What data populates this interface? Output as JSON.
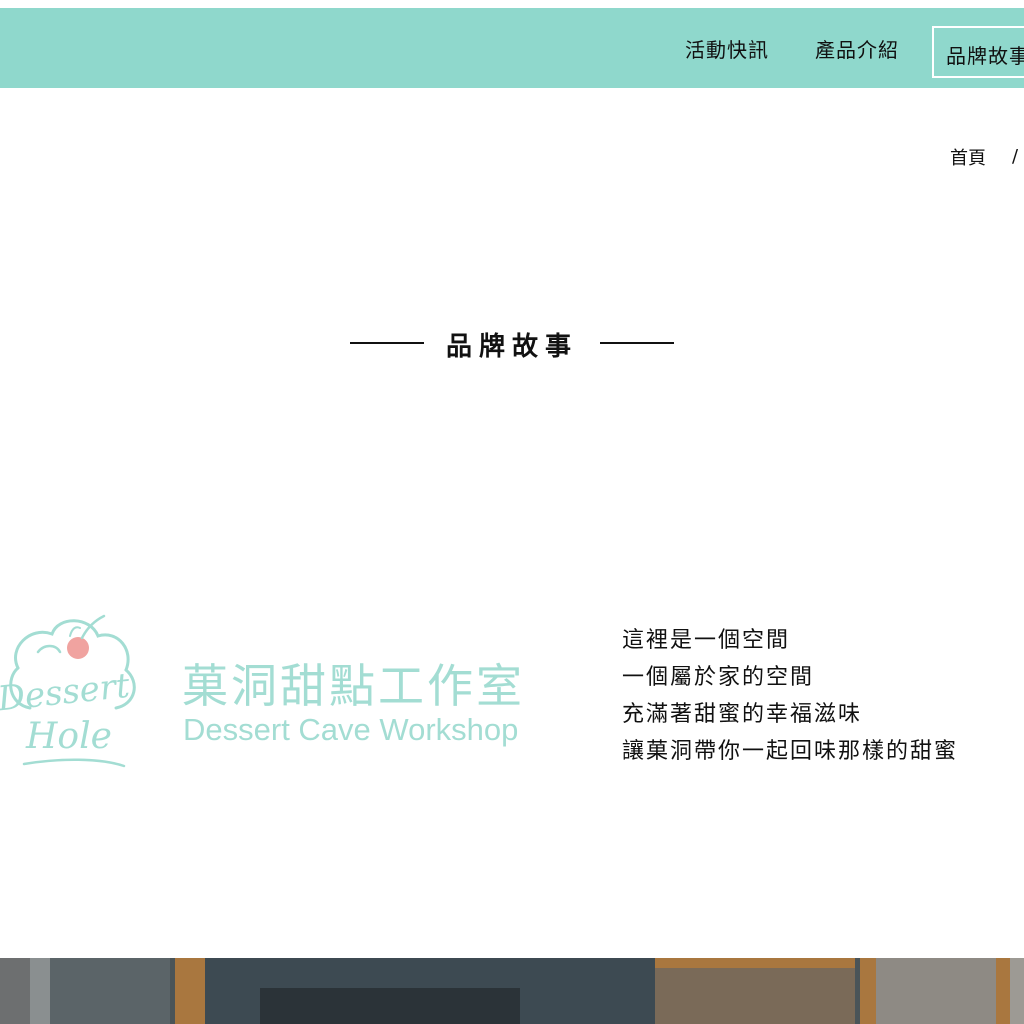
{
  "nav": {
    "items": [
      {
        "label": "活動快訊"
      },
      {
        "label": "產品介紹"
      },
      {
        "label": "品牌故事"
      }
    ],
    "bar_color": "#8fd8cc"
  },
  "breadcrumb": {
    "home": "首頁",
    "separator": "/"
  },
  "section": {
    "title": "品牌故事"
  },
  "brand": {
    "logo_script_top": "Dessert",
    "logo_script_bottom": "Hole",
    "name_zh": "菓洞甜點工作室",
    "name_en": "Dessert Cave Workshop",
    "accent_color": "#a3ddd3",
    "cherry_color": "#f0a3a0"
  },
  "story": {
    "lines": [
      "這裡是一個空間",
      "一個屬於家的空間",
      "充滿著甜蜜的幸福滋味",
      "讓菓洞帶你一起回味那樣的甜蜜"
    ]
  },
  "photo": {
    "icon": "interior-photo"
  }
}
